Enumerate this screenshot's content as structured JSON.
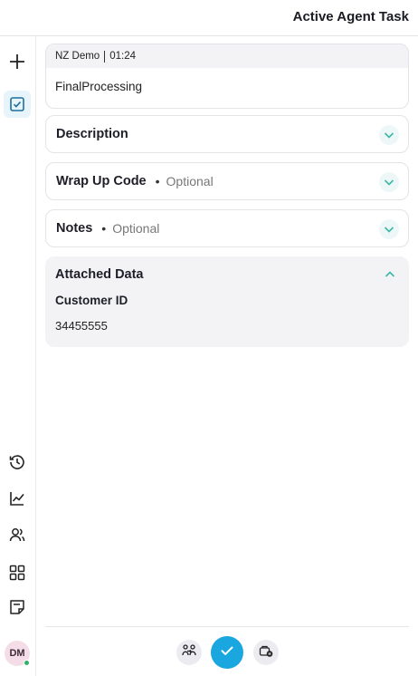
{
  "header": {
    "title": "Active Agent Task"
  },
  "task": {
    "queue": "NZ Demo",
    "timer": "01:24",
    "name": "FinalProcessing"
  },
  "panels": [
    {
      "title": "Description",
      "optional": ""
    },
    {
      "title": "Wrap Up Code",
      "optional": "Optional"
    },
    {
      "title": "Notes",
      "optional": "Optional"
    }
  ],
  "attached": {
    "title": "Attached Data",
    "field_label": "Customer ID",
    "field_value": "34455555"
  },
  "avatar": {
    "initials": "DM",
    "status_color": "#2fb36b"
  },
  "colors": {
    "accent": "#1aa7e0",
    "chevron": "#3bb7a6"
  },
  "icons": {
    "rail": [
      "plus-icon",
      "task-checkbox-icon",
      "history-icon",
      "analytics-icon",
      "contacts-icon",
      "apps-grid-icon",
      "notes-icon"
    ],
    "footer": [
      "transfer-icon",
      "complete-check-icon",
      "hold-icon"
    ]
  }
}
